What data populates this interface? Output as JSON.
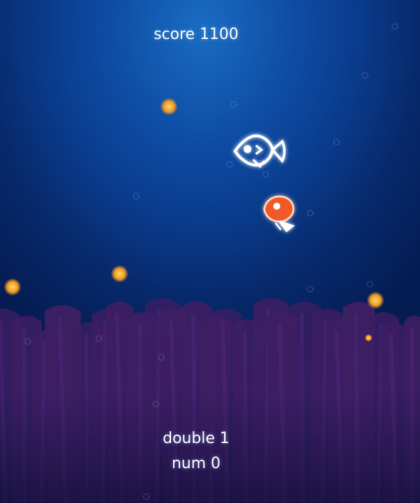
{
  "hud": {
    "score_label": "score",
    "score_value": "1100",
    "double_label": "double",
    "double_value": "1",
    "num_label": "num",
    "num_value": "0"
  },
  "scene": {
    "player": {
      "name": "player-fish",
      "color": "#ffffff"
    },
    "enemy": {
      "name": "enemy-fish",
      "color": "#f05a2a"
    },
    "colors": {
      "water_top": "#1a6cc2",
      "water_bottom": "#051c52",
      "seaweed": "#3e1e63",
      "food": "#f2a22e"
    }
  }
}
